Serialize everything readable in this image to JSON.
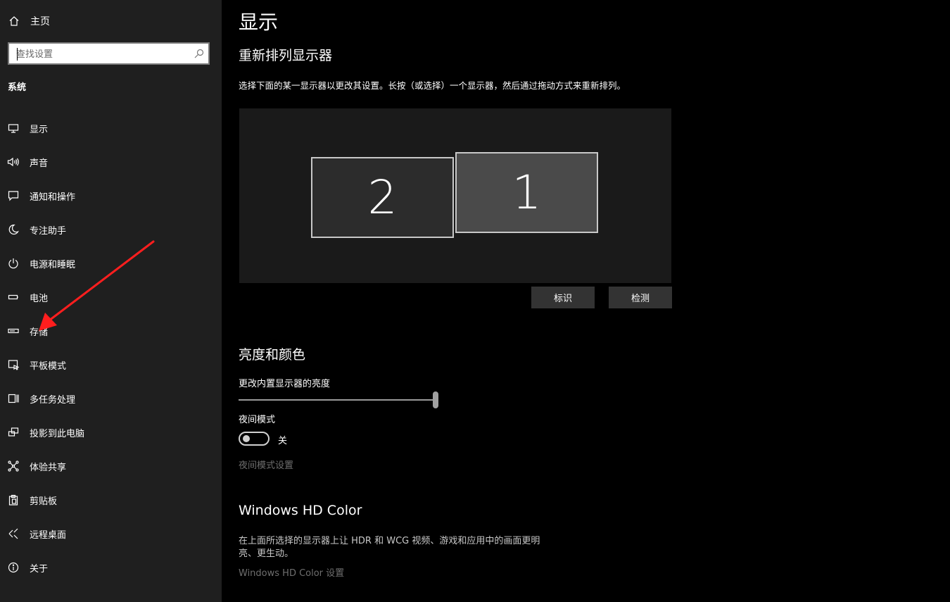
{
  "sidebar": {
    "home_label": "主页",
    "search_placeholder": "查找设置",
    "section_title": "系统",
    "items": [
      {
        "label": "显示",
        "icon": "monitor-icon"
      },
      {
        "label": "声音",
        "icon": "speaker-icon"
      },
      {
        "label": "通知和操作",
        "icon": "notification-icon"
      },
      {
        "label": "专注助手",
        "icon": "moon-icon"
      },
      {
        "label": "电源和睡眠",
        "icon": "power-icon"
      },
      {
        "label": "电池",
        "icon": "battery-icon"
      },
      {
        "label": "存储",
        "icon": "storage-icon"
      },
      {
        "label": "平板模式",
        "icon": "tablet-icon"
      },
      {
        "label": "多任务处理",
        "icon": "multitask-icon"
      },
      {
        "label": "投影到此电脑",
        "icon": "project-icon"
      },
      {
        "label": "体验共享",
        "icon": "share-icon"
      },
      {
        "label": "剪贴板",
        "icon": "clipboard-icon"
      },
      {
        "label": "远程桌面",
        "icon": "remote-desktop-icon"
      },
      {
        "label": "关于",
        "icon": "info-icon"
      }
    ]
  },
  "main": {
    "title": "显示",
    "rearrange": {
      "heading": "重新排列显示器",
      "description": "选择下面的某一显示器以更改其设置。长按（或选择）一个显示器，然后通过拖动方式来重新排列。",
      "monitors": [
        "2",
        "1"
      ],
      "identify_label": "标识",
      "detect_label": "检测"
    },
    "brightness": {
      "heading": "亮度和颜色",
      "slider_label": "更改内置显示器的亮度",
      "slider_value_fraction": 1.0,
      "night_mode_label": "夜间模式",
      "night_mode_state": "关",
      "night_mode_settings_link": "夜间模式设置"
    },
    "hdr": {
      "heading": "Windows HD Color",
      "description": "在上面所选择的显示器上让 HDR 和 WCG 视频、游戏和应用中的画面更明亮、更生动。",
      "settings_link": "Windows HD Color 设置"
    }
  },
  "colors": {
    "sidebar_bg": "#1f1f1f",
    "main_bg": "#000000",
    "annotation_arrow": "#ff1e1e"
  }
}
